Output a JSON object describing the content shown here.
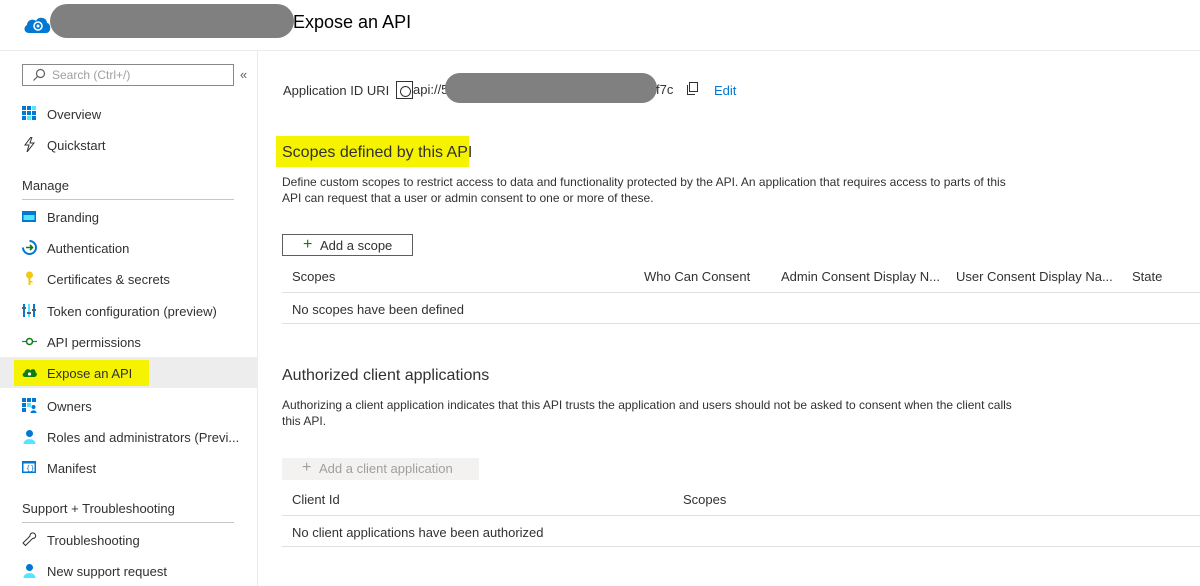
{
  "header": {
    "title": "Expose an API"
  },
  "sidebar": {
    "search_placeholder": "Search (Ctrl+/)",
    "collapse_icon": "«",
    "top_items": [
      {
        "label": "Overview",
        "icon": "overview-grid-icon"
      },
      {
        "label": "Quickstart",
        "icon": "lightning-icon"
      }
    ],
    "manage_heading": "Manage",
    "manage_items": [
      {
        "label": "Branding",
        "icon": "branding-icon"
      },
      {
        "label": "Authentication",
        "icon": "authentication-icon"
      },
      {
        "label": "Certificates & secrets",
        "icon": "key-icon"
      },
      {
        "label": "Token configuration (preview)",
        "icon": "token-bars-icon"
      },
      {
        "label": "API permissions",
        "icon": "api-permissions-icon"
      },
      {
        "label": "Expose an API",
        "icon": "cloud-api-icon"
      },
      {
        "label": "Owners",
        "icon": "owners-grid-icon"
      },
      {
        "label": "Roles and administrators (Previ...",
        "icon": "roles-person-icon"
      },
      {
        "label": "Manifest",
        "icon": "manifest-icon"
      }
    ],
    "support_heading": "Support + Troubleshooting",
    "support_items": [
      {
        "label": "Troubleshooting",
        "icon": "wrench-icon"
      },
      {
        "label": "New support request",
        "icon": "support-person-icon"
      }
    ]
  },
  "main": {
    "app_id": {
      "label": "Application ID URI",
      "value_prefix": "api://5",
      "value_suffix": "f7c",
      "edit_label": "Edit"
    },
    "scopes": {
      "title": "Scopes defined by this API",
      "description_line1": "Define custom scopes to restrict access to data and functionality protected by the API. An application that requires access to parts of this",
      "description_line2": "API can request that a user or admin consent to one or more of these.",
      "add_button": "Add a scope",
      "columns": [
        "Scopes",
        "Who Can Consent",
        "Admin Consent Display N...",
        "User Consent Display Na...",
        "State"
      ],
      "empty_text": "No scopes have been defined"
    },
    "authorized": {
      "title": "Authorized client applications",
      "description_line1": "Authorizing a client application indicates that this API trusts the application and users should not be asked to consent when the client calls",
      "description_line2": "this API.",
      "add_button": "Add a client application",
      "columns": [
        "Client Id",
        "Scopes"
      ],
      "empty_text": "No client applications have been authorized"
    }
  },
  "colors": {
    "accent": "#0078d4",
    "highlight": "#f5f300",
    "active_bg": "#ededed",
    "plus_green": "#107c10"
  }
}
